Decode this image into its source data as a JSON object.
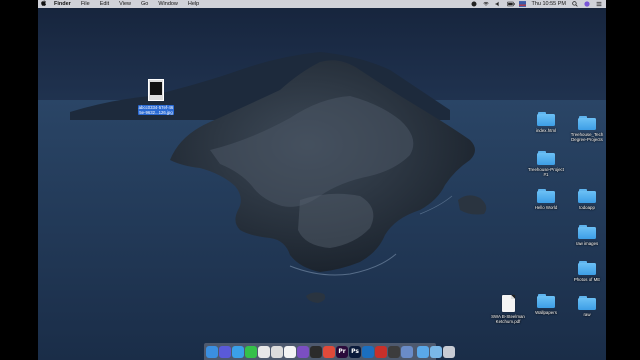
{
  "menubar": {
    "apple": "",
    "app_name": "Finder",
    "items": [
      "File",
      "Edit",
      "View",
      "Go",
      "Window",
      "Help"
    ],
    "clock": "Thu 10:55 PM"
  },
  "desktop": {
    "selected_file": {
      "label_line1": "abcc0334-57ef-46",
      "label_line2": "5e-9632...126.jpg"
    },
    "icons": [
      {
        "label": "index.html",
        "kind": "folder"
      },
      {
        "label": "Treehouse_Tech\nDegree-Projects",
        "kind": "folder"
      },
      {
        "label": "Treehouse-Project\n#1",
        "kind": "folder"
      },
      {
        "label": "Hello World",
        "kind": "folder"
      },
      {
        "label": "todoapp",
        "kind": "folder"
      },
      {
        "label": "raw images",
        "kind": "folder"
      },
      {
        "label": "Photos of ME",
        "kind": "folder"
      },
      {
        "label": "SWA B-Steelman\nKetchum.pdf",
        "kind": "document"
      },
      {
        "label": "Wallpapers",
        "kind": "folder"
      },
      {
        "label": "raw",
        "kind": "folder"
      }
    ]
  },
  "dock": {
    "apps": [
      {
        "name": "finder-icon",
        "color": "#3b8fe0",
        "glyph": ""
      },
      {
        "name": "siri-icon",
        "color": "#5a5ad8",
        "glyph": ""
      },
      {
        "name": "safari-icon",
        "color": "#3aa0e8",
        "glyph": ""
      },
      {
        "name": "messages-icon",
        "color": "#35c04a",
        "glyph": ""
      },
      {
        "name": "photos-icon",
        "color": "#e8e8e8",
        "glyph": ""
      },
      {
        "name": "chrome-icon",
        "color": "#dcdcdc",
        "glyph": ""
      },
      {
        "name": "calendar-icon",
        "color": "#f4f4f4",
        "glyph": ""
      },
      {
        "name": "github-icon",
        "color": "#7b4fc2",
        "glyph": ""
      },
      {
        "name": "terminal-icon",
        "color": "#2b2b2b",
        "glyph": ""
      },
      {
        "name": "chrome-alt-icon",
        "color": "#e04a3a",
        "glyph": ""
      },
      {
        "name": "premiere-icon",
        "color": "#2a0a3a",
        "glyph": "Pr"
      },
      {
        "name": "photoshop-icon",
        "color": "#0a1a3a",
        "glyph": "Ps"
      },
      {
        "name": "vscode-icon",
        "color": "#1b6fc0",
        "glyph": ""
      },
      {
        "name": "app-red-icon",
        "color": "#c8302a",
        "glyph": ""
      },
      {
        "name": "quicktime-icon",
        "color": "#3c3c3c",
        "glyph": ""
      },
      {
        "name": "search-icon",
        "color": "#6a8cc8",
        "glyph": ""
      },
      {
        "name": "downloads-icon",
        "color": "#5aa8e8",
        "glyph": ""
      },
      {
        "name": "folder-icon",
        "color": "#7ab8e8",
        "glyph": ""
      },
      {
        "name": "trash-icon",
        "color": "#c8ccd4",
        "glyph": ""
      }
    ]
  }
}
